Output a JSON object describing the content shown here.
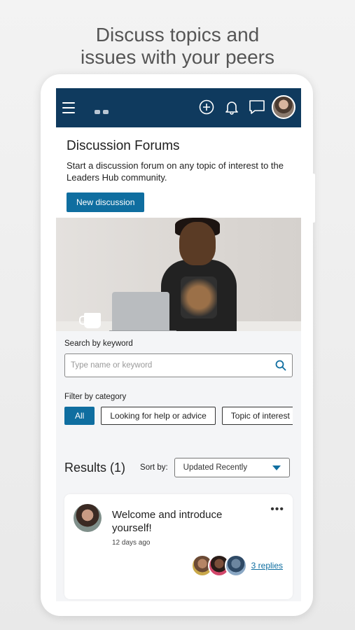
{
  "headline": {
    "line1": "Discuss topics and",
    "line2": "issues with your peers"
  },
  "topbar": {
    "menu_icon": "hamburger-icon",
    "icons": [
      "add-circle-icon",
      "bell-icon",
      "chat-icon"
    ],
    "color": "#0f3a5e"
  },
  "intro": {
    "title": "Discussion Forums",
    "description": "Start a discussion forum on any topic of interest to the Leaders Hub community.",
    "new_button": "New discussion"
  },
  "search": {
    "label": "Search by keyword",
    "placeholder": "Type name or keyword"
  },
  "filter": {
    "label": "Filter by category",
    "chips": [
      "All",
      "Looking for help or advice",
      "Topic of interest"
    ]
  },
  "results": {
    "title": "Results (1)",
    "sort_label": "Sort by:",
    "sort_value": "Updated Recently"
  },
  "card": {
    "title": "Welcome and introduce yourself!",
    "time": "12 days ago",
    "replies": "3 replies"
  },
  "colors": {
    "accent": "#0f6ea0",
    "topbar": "#0f3a5e"
  }
}
